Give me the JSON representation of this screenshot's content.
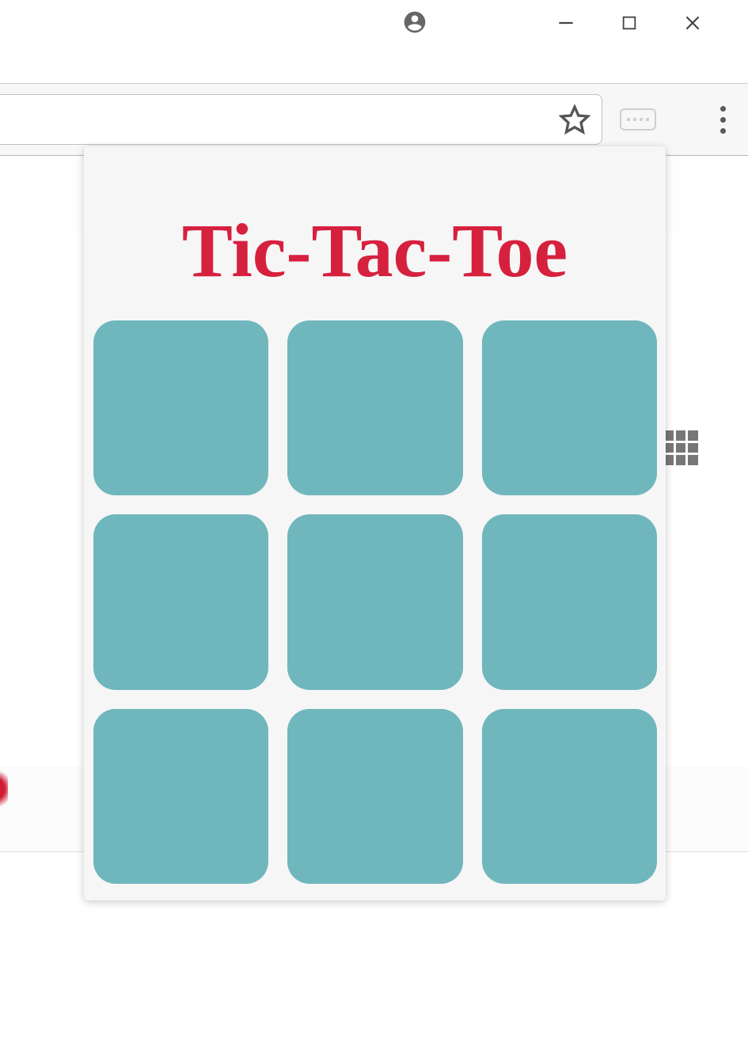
{
  "window": {
    "title": "",
    "avatar_icon": "account-circle-icon",
    "buttons": {
      "minimize": "minimize",
      "maximize": "maximize",
      "close": "close"
    }
  },
  "toolbar": {
    "address_value": "",
    "star_icon": "star-icon",
    "extensions_icon": "extensions-icon",
    "menu_icon": "kebab-menu-icon"
  },
  "page": {
    "apps_icon": "apps-grid-icon"
  },
  "game": {
    "title": "Tic-Tac-Toe",
    "board": [
      "",
      "",
      "",
      "",
      "",
      "",
      "",
      "",
      ""
    ],
    "colors": {
      "cell": "#70b6bd",
      "title": "#d6213e",
      "card_bg": "#f6f6f6"
    }
  }
}
